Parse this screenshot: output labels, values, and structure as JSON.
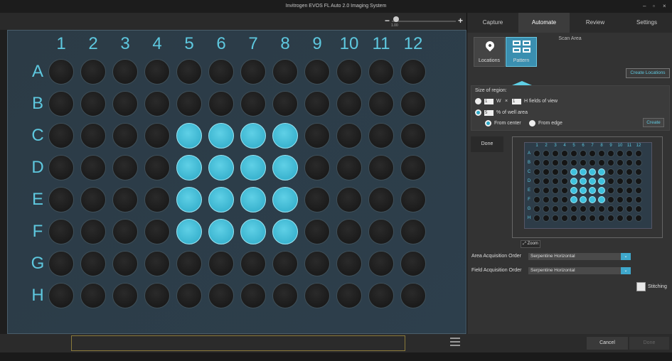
{
  "window": {
    "title": "Invitrogen EVOS FL Auto 2.0 Imaging System",
    "minimize": "–",
    "maximize": "▫",
    "close": "×"
  },
  "zoom": {
    "value": "1.00",
    "minus": "−",
    "plus": "+"
  },
  "plate": {
    "columns": [
      "1",
      "2",
      "3",
      "4",
      "5",
      "6",
      "7",
      "8",
      "9",
      "10",
      "11",
      "12"
    ],
    "rows": [
      "A",
      "B",
      "C",
      "D",
      "E",
      "F",
      "G",
      "H"
    ],
    "selected_wells": [
      "C5",
      "C6",
      "C7",
      "C8",
      "D5",
      "D6",
      "D7",
      "D8",
      "E5",
      "E6",
      "E7",
      "E8",
      "F5",
      "F6",
      "F7",
      "F8"
    ]
  },
  "tabs": [
    {
      "label": "Capture"
    },
    {
      "label": "Automate"
    },
    {
      "label": "Review"
    },
    {
      "label": "Settings"
    }
  ],
  "active_tab": "Automate",
  "scan_area": {
    "heading": "Scan Area",
    "locations_label": "Locations",
    "pattern_label": "Pattern",
    "create_locations_label": "Create Locations",
    "size_of_region_label": "Size of region:",
    "fields_w": "1",
    "w_label": "W",
    "times": "×",
    "fields_h": "1",
    "h_label": "H  fields of view",
    "percent_value": "5",
    "percent_label": "% of well area",
    "from_center_label": "From center",
    "from_edge_label": "From edge",
    "create_label": "Create",
    "done_label": "Done",
    "zoom_label": "Zoom"
  },
  "acquisition": {
    "area_label": "Area Acquisition Order",
    "area_value": "Serpentine Horizontal",
    "field_label": "Field Acquisition Order",
    "field_value": "Serpentine Horizontal",
    "dropdown_arrow": "⌄",
    "stitching_label": "Stitching"
  },
  "footer": {
    "cancel_label": "Cancel",
    "done_label": "Done"
  },
  "colors": {
    "accent": "#5ec8df",
    "selected_well": "#3fc2de",
    "plate_bg": "#2d3f4c"
  },
  "icons": [
    "location-pin-icon",
    "pattern-grid-icon",
    "zoom-icon",
    "sliders-icon",
    "dropdown-arrow-icon"
  ]
}
